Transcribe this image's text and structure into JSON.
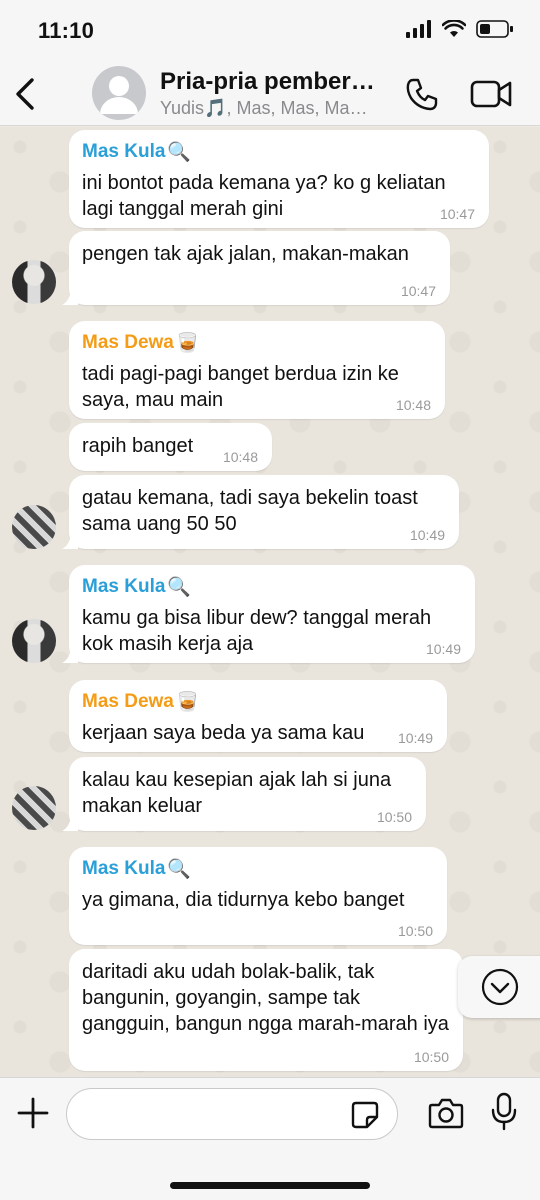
{
  "status_bar": {
    "time": "11:10"
  },
  "header": {
    "group_name": "Pria-pria pember…",
    "members": "Yudis🎵, Mas, Mas, Ma…"
  },
  "colors": {
    "mas_kula": "#2a9fd8",
    "mas_dewa": "#f59c16",
    "tick_gray": "#9a9a9a"
  },
  "messages": [
    {
      "sender": "Mas Kula",
      "sender_emoji": "🔍",
      "text": "ini bontot pada kemana ya? ko g keliatan lagi tanggal merah gini",
      "time": "10:47"
    },
    {
      "sender": "",
      "text": "pengen tak ajak jalan, makan-makan",
      "time": "10:47"
    },
    {
      "sender": "Mas Dewa",
      "sender_emoji": "🥃",
      "text": "tadi pagi-pagi banget berdua izin ke saya, mau main",
      "time": "10:48"
    },
    {
      "sender": "",
      "text": "rapih banget",
      "time": "10:48"
    },
    {
      "sender": "",
      "text": "gatau kemana, tadi saya bekelin toast sama uang 50 50",
      "time": "10:49"
    },
    {
      "sender": "Mas Kula",
      "sender_emoji": "🔍",
      "text": "kamu ga bisa libur dew? tanggal merah kok masih kerja aja",
      "time": "10:49"
    },
    {
      "sender": "Mas Dewa",
      "sender_emoji": "🥃",
      "text": "kerjaan saya beda ya sama kau",
      "time": "10:49"
    },
    {
      "sender": "",
      "text": "kalau kau kesepian ajak lah si juna makan keluar",
      "time": "10:50"
    },
    {
      "sender": "Mas Kula",
      "sender_emoji": "🔍",
      "text": "ya gimana, dia tidurnya kebo banget",
      "time": "10:50"
    },
    {
      "sender": "",
      "text": "daritadi aku udah bolak-balik, tak bangunin, goyangin, sampe tak gangguin, bangun ngga marah-marah iya",
      "time": "10:50"
    }
  ],
  "icons": {
    "back": "chevron-left-icon",
    "call": "phone-icon",
    "video": "video-camera-icon",
    "plus": "plus-icon",
    "sticker": "sticker-icon",
    "camera": "camera-icon",
    "mic": "microphone-icon",
    "scroll": "chevron-down-circle-icon"
  }
}
